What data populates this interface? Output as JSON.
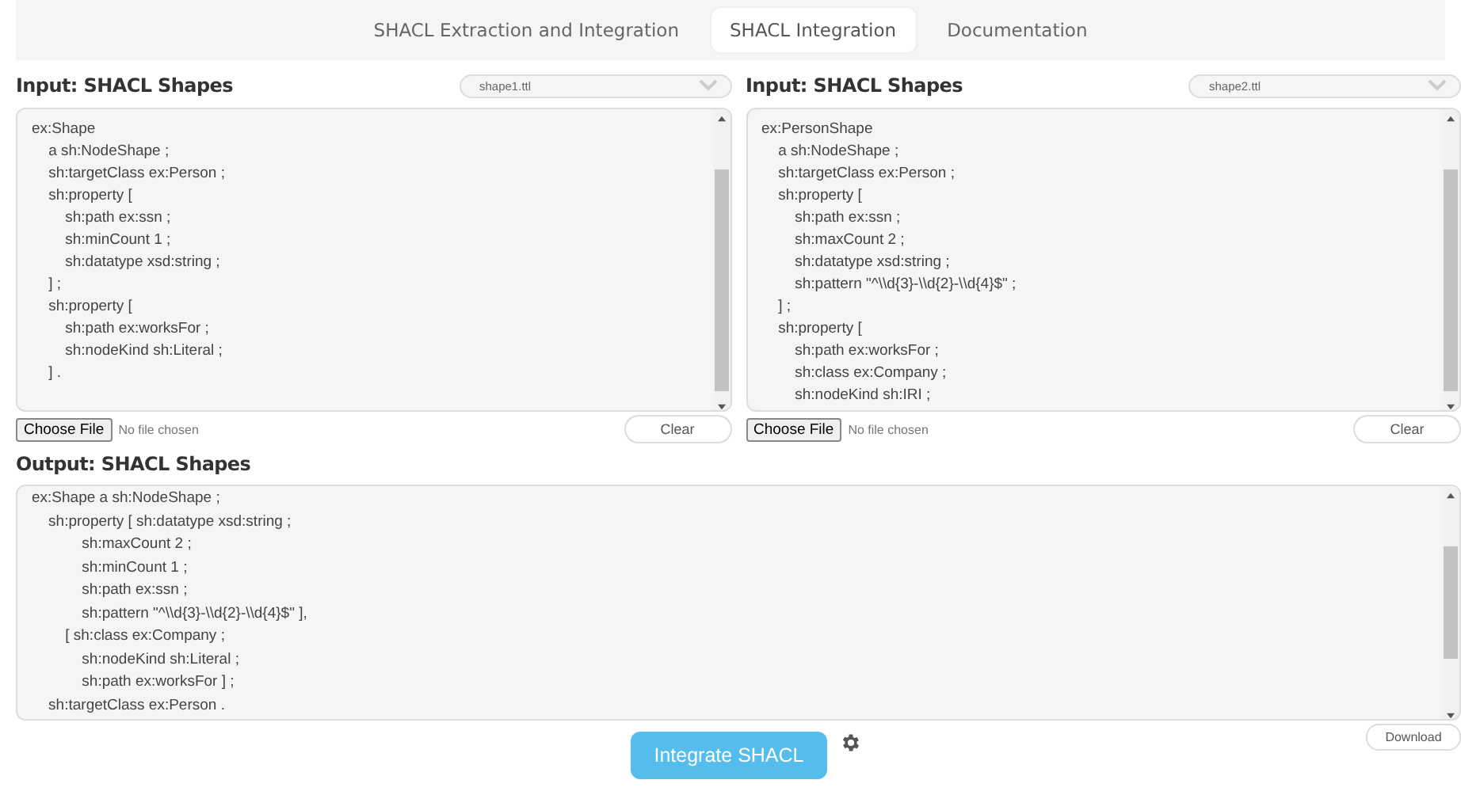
{
  "tabs": [
    {
      "label": "SHACL Extraction and Integration",
      "selected": false
    },
    {
      "label": "SHACL Integration",
      "selected": true
    },
    {
      "label": "Documentation",
      "selected": false
    }
  ],
  "inputs": [
    {
      "title": "Input: SHACL Shapes",
      "file_select": "shape1.ttl",
      "value": "ex:Shape\n\ta sh:NodeShape ;\n\tsh:targetClass ex:Person ;\n\tsh:property [\n\t\tsh:path ex:ssn ;\n\t\tsh:minCount 1 ;\n\t\tsh:datatype xsd:string ;\n\t] ;\n\tsh:property [\n\t\tsh:path ex:worksFor ;\n\t\tsh:nodeKind sh:Literal ;\n\t] .",
      "choose_file": "Choose File",
      "file_status": "No file chosen",
      "clear": "Clear"
    },
    {
      "title": "Input: SHACL Shapes",
      "file_select": "shape2.ttl",
      "value": "ex:PersonShape\n\ta sh:NodeShape ;\n\tsh:targetClass ex:Person ;\n\tsh:property [\n\t\tsh:path ex:ssn ;\n\t\tsh:maxCount 2 ;\n\t\tsh:datatype xsd:string ;\n\t\tsh:pattern \"^\\\\d{3}-\\\\d{2}-\\\\d{4}$\" ;\n\t] ;\n\tsh:property [\n\t\tsh:path ex:worksFor ;\n\t\tsh:class ex:Company ;\n\t\tsh:nodeKind sh:IRI ;",
      "choose_file": "Choose File",
      "file_status": "No file chosen",
      "clear": "Clear"
    }
  ],
  "output": {
    "title": "Output: SHACL Shapes",
    "value": "ex:Shape a sh:NodeShape ;\n    sh:property [ sh:datatype xsd:string ;\n            sh:maxCount 2 ;\n            sh:minCount 1 ;\n            sh:path ex:ssn ;\n            sh:pattern \"^\\\\d{3}-\\\\d{2}-\\\\d{4}$\" ],\n        [ sh:class ex:Company ;\n            sh:nodeKind sh:Literal ;\n            sh:path ex:worksFor ] ;\n    sh:targetClass ex:Person .",
    "download": "Download"
  },
  "integrate_button": "Integrate SHACL"
}
